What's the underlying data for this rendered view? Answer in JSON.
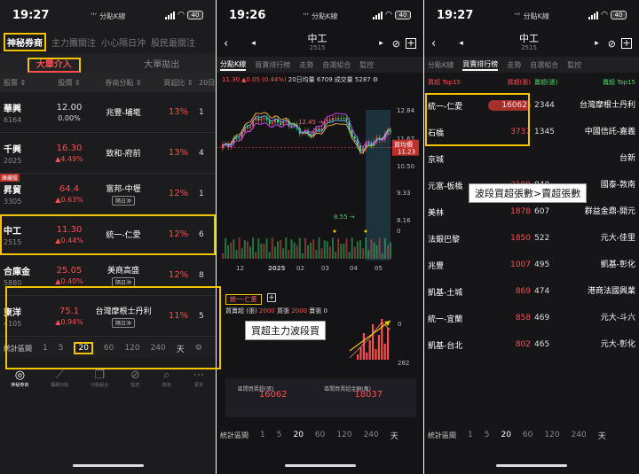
{
  "panel1": {
    "status": {
      "time": "19:27",
      "app": "分點K線",
      "battery": "40"
    },
    "nav": [
      "神秘券商",
      "主力團關注",
      "小心隔日沖",
      "股民最關注"
    ],
    "subtabs": [
      "大單介入",
      "大單拋出"
    ],
    "columns": [
      "股票",
      "股價",
      "券商分點",
      "買超比",
      "20日"
    ],
    "rows": [
      {
        "name": "華興",
        "code": "6164",
        "price": "12.00",
        "change": "0.00%",
        "broker": "兆豐-埔墘",
        "tag": "",
        "pct": "13%",
        "day": "1",
        "sector": ""
      },
      {
        "name": "千興",
        "code": "2025",
        "price": "16.30",
        "change": "▲4.49%",
        "broker": "致和-府前",
        "tag": "",
        "pct": "13%",
        "day": "4",
        "sector": ""
      },
      {
        "name": "昇貿",
        "code": "3305",
        "price": "64.4",
        "change": "▲0.63%",
        "broker": "富邦-中壢",
        "tag": "隔日沖",
        "pct": "12%",
        "day": "1",
        "sector": "庫藏股"
      },
      {
        "name": "中工",
        "code": "2515",
        "price": "11.30",
        "change": "▲0.44%",
        "broker": "統一-仁愛",
        "tag": "",
        "pct": "12%",
        "day": "6",
        "sector": ""
      },
      {
        "name": "合庫金",
        "code": "5880",
        "price": "25.05",
        "change": "▲0.40%",
        "broker": "美商高盛",
        "tag": "隔日沖",
        "pct": "12%",
        "day": "8",
        "sector": ""
      },
      {
        "name": "東洋",
        "code": "4105",
        "price": "75.1",
        "change": "▲0.94%",
        "broker": "台灣摩根士丹利",
        "tag": "隔日沖",
        "pct": "11%",
        "day": "5",
        "sector": ""
      }
    ],
    "statbar": {
      "label": "統計區間",
      "options": [
        "1",
        "5",
        "20",
        "60",
        "120",
        "240"
      ],
      "unit": "天",
      "selected": "20"
    },
    "bottomnav": [
      "神秘券商",
      "籌碼分點",
      "分點組合",
      "監控",
      "搜尋",
      "更多"
    ]
  },
  "panel2": {
    "status": {
      "time": "19:26",
      "app": "分點K線",
      "battery": "40"
    },
    "title": "中工",
    "code": "2515",
    "tabs": [
      "分點K線",
      "買賣排行榜",
      "走勢",
      "自選組合",
      "監控"
    ],
    "info": {
      "range": "11.30",
      "change": "▲0.05",
      "pct": "(0.44%)",
      "ma": "20日均量 6709",
      "vol": "成交量 5287"
    },
    "broker": {
      "name": "統一-仁愛",
      "buy_label": "買賣超 (張)",
      "buy": "2000",
      "b_label": "買張",
      "b": "2000",
      "s_label": "賣張",
      "s": "0"
    },
    "callout": "買超主力波段買",
    "summary": [
      {
        "label": "區間買賣超(張)",
        "value": "16062"
      },
      {
        "label": "區間買賣超金額(萬)",
        "value": "18037"
      }
    ],
    "statbar": {
      "label": "統計區間",
      "options": [
        "1",
        "5",
        "20",
        "60",
        "120",
        "240"
      ],
      "unit": "天",
      "selected": "20"
    }
  },
  "panel3": {
    "status": {
      "time": "19:27",
      "app": "分點K線",
      "battery": "40"
    },
    "title": "中工",
    "code": "2515",
    "tabs": [
      "分點K線",
      "買賣排行榜",
      "走勢",
      "自選組合",
      "監控"
    ],
    "head": {
      "buy": "買超 Top15",
      "buycol": "買超(張)",
      "sellcol": "賣超(張)",
      "sell": "賣超 Top15"
    },
    "callout": "波段買超張數>賣超張數",
    "rows": [
      {
        "b": "統一-仁愛",
        "bv": "16062",
        "sv": "2344",
        "s": "台灣摩根士丹利"
      },
      {
        "b": "石橋",
        "bv": "3737",
        "sv": "1345",
        "s": "中國信託-嘉義"
      },
      {
        "b": "京城",
        "bv": "",
        "sv": "",
        "s": "台新"
      },
      {
        "b": "元富-板橋",
        "bv": "2100",
        "sv": "840",
        "s": "國泰-敦南"
      },
      {
        "b": "美林",
        "bv": "1878",
        "sv": "607",
        "s": "群益金鼎-開元"
      },
      {
        "b": "法銀巴黎",
        "bv": "1850",
        "sv": "522",
        "s": "元大-佳里"
      },
      {
        "b": "兆豐",
        "bv": "1007",
        "sv": "495",
        "s": "凱基-彰化"
      },
      {
        "b": "凱基-土城",
        "bv": "869",
        "sv": "474",
        "s": "港商法國興業"
      },
      {
        "b": "統一-宜蘭",
        "bv": "858",
        "sv": "469",
        "s": "元大-斗六"
      },
      {
        "b": "凱基-台北",
        "bv": "802",
        "sv": "465",
        "s": "元大-彰化"
      }
    ],
    "statbar": {
      "label": "統計區間",
      "options": [
        "1",
        "5",
        "20",
        "60",
        "120",
        "240"
      ],
      "unit": "天",
      "selected": "20"
    }
  },
  "chart_data": {
    "type": "candlestick",
    "x": [
      "12",
      "2025",
      "02",
      "03",
      "04",
      "05"
    ],
    "y_ticks": [
      "12.84",
      "11.67",
      "10.50",
      "9.33",
      "8.16",
      "0"
    ],
    "annotations": [
      "12.45",
      "8.55",
      "買均價 11.23"
    ],
    "volume_ticks": [
      "0",
      "282"
    ]
  }
}
